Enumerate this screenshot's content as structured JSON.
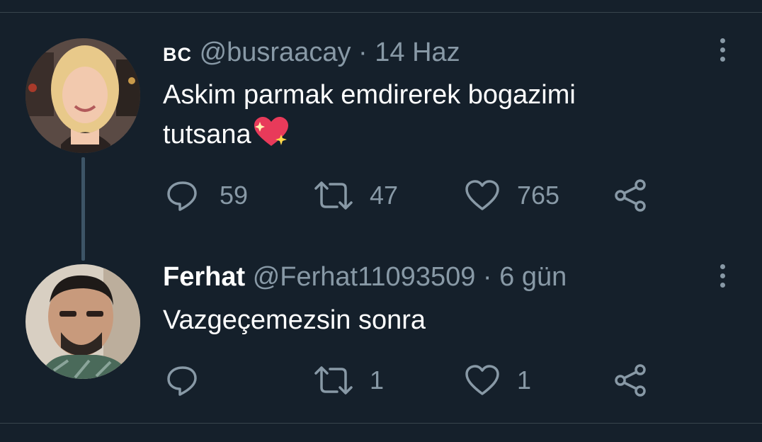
{
  "tweets": [
    {
      "display_name": "BC",
      "handle": "@busraacay",
      "separator": "·",
      "time": "14 Haz",
      "text_line1": "Askim parmak emdirerek bogazimi",
      "text_line2": "tutsana",
      "emoji": "sparkling-heart-emoji",
      "replies": "59",
      "retweets": "47",
      "likes": "765"
    },
    {
      "display_name": "Ferhat",
      "handle": "@Ferhat11093509",
      "separator": "·",
      "time": "6 gün",
      "text_line1": "Vazgeçemezsin sonra",
      "replies": "",
      "retweets": "1",
      "likes": "1"
    }
  ],
  "colors": {
    "background": "#15202b",
    "secondary_text": "#8899a6",
    "thread_line": "#3d5466",
    "divider": "#38444d"
  }
}
